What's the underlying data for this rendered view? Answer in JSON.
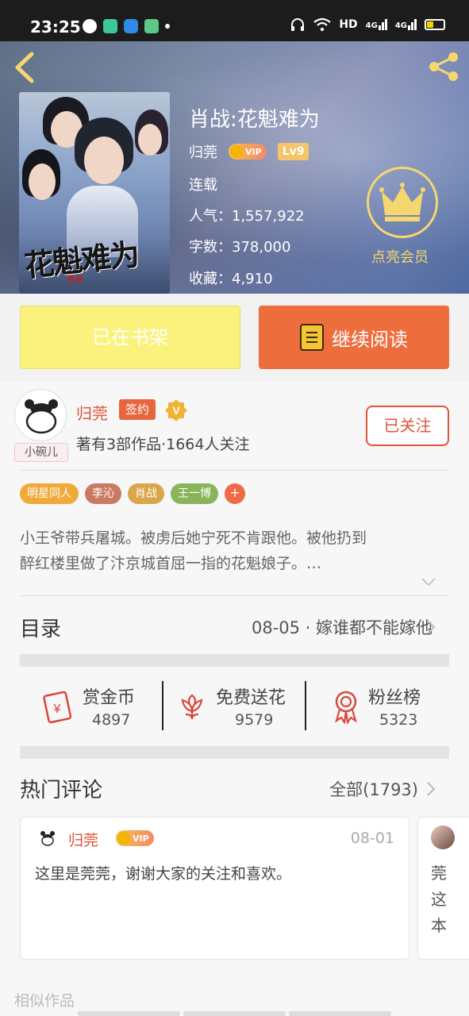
{
  "status_bar": {
    "time": "23:25",
    "network_label": "HD",
    "signal_1": "4G",
    "signal_2": "4G",
    "battery_color": "#f4d000"
  },
  "book": {
    "title": "肖战:花魁难为",
    "cover_title": "花魁难为",
    "cover_subtitle": "肖战",
    "author": "归莞",
    "vip_label": "VIP",
    "level": "Lv9",
    "status": "连载",
    "popularity": "人气：1,557,922",
    "word_count": "字数：378,000",
    "favorites": "收藏：4,910"
  },
  "membership": {
    "label": "点亮会员",
    "color": "#f5d76e"
  },
  "actions": {
    "shelf_label": "已在书架",
    "read_label": "继续阅读",
    "read_color": "#ed6d3d",
    "shelf_color": "#fbf27e"
  },
  "author_info": {
    "name": "归莞",
    "avatar_tag": "小碗儿",
    "sign_badge": "签约",
    "v_badge": "V",
    "stats": "著有3部作品·1664人关注",
    "follow_label": "已关注"
  },
  "tags": [
    {
      "label": "明星同人",
      "color": "#f1a93a"
    },
    {
      "label": "李沁",
      "color": "#c97a62"
    },
    {
      "label": "肖战",
      "color": "#d9a64a"
    },
    {
      "label": "王一博",
      "color": "#8ab45a"
    }
  ],
  "tag_more": "+",
  "synopsis": {
    "line1": "小王爷带兵屠城。被虏后她宁死不肯跟他。被他扔到",
    "line2": "醉红楼里做了汴京城首屈一指的花魁娘子。…"
  },
  "toc": {
    "title": "目录",
    "latest": "08-05 · 嫁谁都不能嫁他"
  },
  "stats": [
    {
      "label": "赏金币",
      "value": "4897",
      "icon": "red-envelope-icon"
    },
    {
      "label": "免费送花",
      "value": "9579",
      "icon": "flower-icon"
    },
    {
      "label": "粉丝榜",
      "value": "5323",
      "icon": "medal-icon"
    }
  ],
  "comments": {
    "title": "热门评论",
    "all_label": "全部(1793)",
    "items": [
      {
        "name": "归莞",
        "vip": "VIP",
        "date": "08-01",
        "text": "这里是莞莞，谢谢大家的关注和喜欢。"
      },
      {
        "text": "莞这本"
      }
    ]
  },
  "similar_title": "相似作品"
}
